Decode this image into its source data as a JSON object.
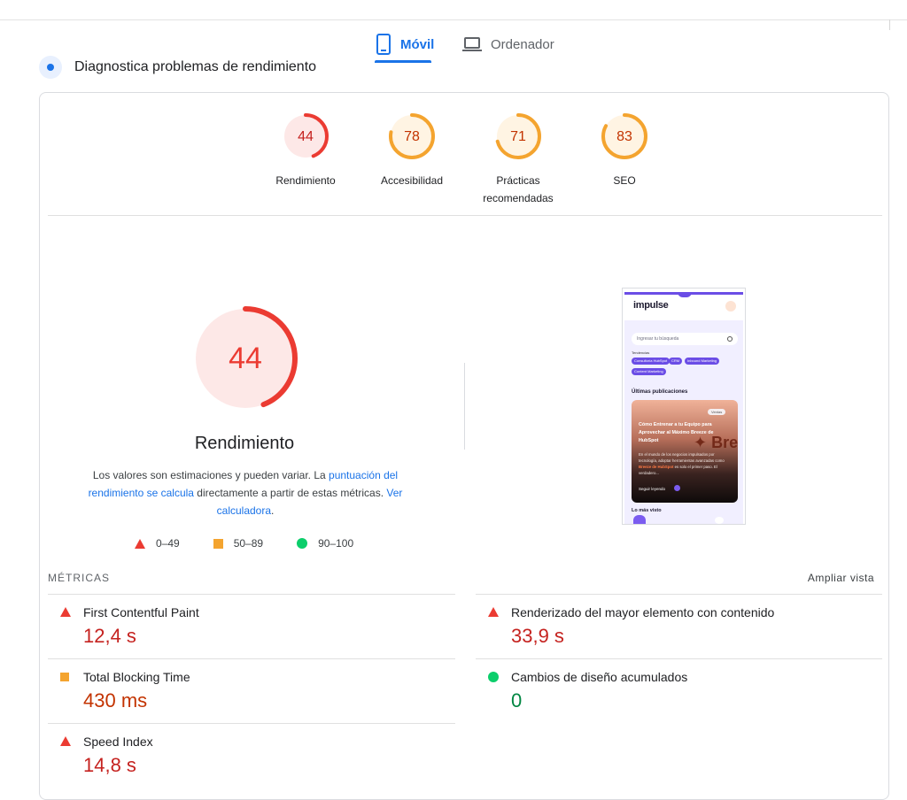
{
  "tabs": {
    "mobile_label": "Móvil",
    "desktop_label": "Ordenador"
  },
  "diagnose_title": "Diagnostica problemas de rendimiento",
  "categories": [
    {
      "score": "44",
      "label": "Rendimiento",
      "fraction": 0.44,
      "color": "#eb3b32",
      "bg": "#fde8e7",
      "text_color": "#c5221f"
    },
    {
      "score": "78",
      "label": "Accesibilidad",
      "fraction": 0.78,
      "color": "#f4a42f",
      "bg": "#fff4e3",
      "text_color": "#c33300"
    },
    {
      "score": "71",
      "label_line1": "Prácticas",
      "label_line2": "recomendadas",
      "fraction": 0.71,
      "color": "#f4a42f",
      "bg": "#fff4e3",
      "text_color": "#c33300"
    },
    {
      "score": "83",
      "label": "SEO",
      "fraction": 0.83,
      "color": "#f4a42f",
      "bg": "#fff4e3",
      "text_color": "#c33300"
    }
  ],
  "performance": {
    "score": "44",
    "fraction": 0.44,
    "title": "Rendimiento",
    "desc_part1": "Los valores son estimaciones y pueden variar. La ",
    "desc_link1": "puntuación del rendimiento se calcula",
    "desc_part2": " directamente a partir de estas métricas. ",
    "desc_link2": "Ver calculadora",
    "desc_part3": "."
  },
  "legend": {
    "bad": "0–49",
    "average": "50–89",
    "good": "90–100"
  },
  "screenshot": {
    "logo": "impulse",
    "search_placeholder": "Ingresar tu búsqueda",
    "trends_label": "Tendencias",
    "chips": [
      "Consultoría HubSpot",
      "CRM",
      "Inbound Marketing",
      "Content Marketing"
    ],
    "latest_title": "Últimas publicaciones",
    "post_badge": "Ventas",
    "post_title": "Cómo Entrenar a tu Equipo para Aprovechar al Máximo Breeze de HubSpot",
    "post_text_a": "En el mundo de los negocios impulsados por tecnología, adoptar herramientas avanzadas como ",
    "post_text_highlight": "Breeze de HubSpot",
    "post_text_b": " es solo el primer paso. El verdadero...",
    "post_overlay": "✦ Bre",
    "read_more": "Seguir leyendo",
    "most_viewed": "Lo más visto"
  },
  "metrics": {
    "header": "MÉTRICAS",
    "expand": "Ampliar vista",
    "items": [
      {
        "name": "First Contentful Paint",
        "value": "12,4 s",
        "status": "bad"
      },
      {
        "name": "Renderizado del mayor elemento con contenido",
        "value": "33,9 s",
        "status": "bad"
      },
      {
        "name": "Total Blocking Time",
        "value": "430 ms",
        "status": "average"
      },
      {
        "name": "Cambios de diseño acumulados",
        "value": "0",
        "status": "good"
      },
      {
        "name": "Speed Index",
        "value": "14,8 s",
        "status": "bad"
      }
    ]
  }
}
